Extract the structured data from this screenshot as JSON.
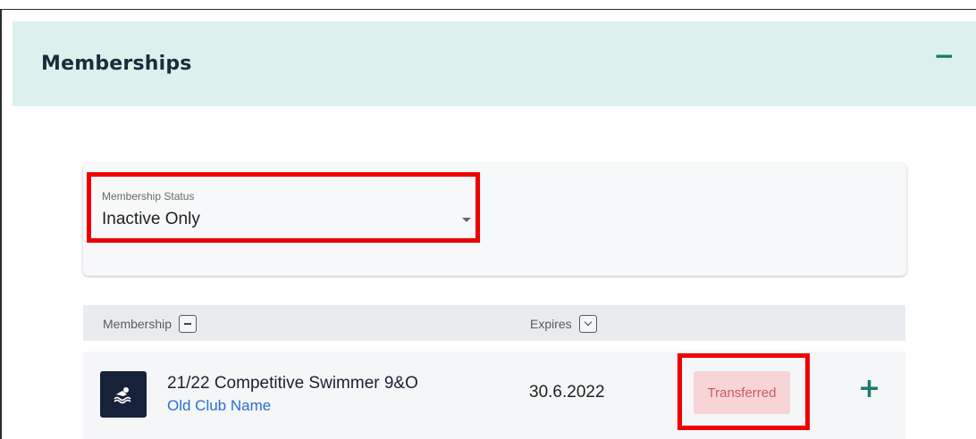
{
  "panel": {
    "title": "Memberships",
    "collapse_symbol": "−"
  },
  "filter": {
    "label": "Membership Status",
    "value": "Inactive Only"
  },
  "table": {
    "columns": [
      "Membership",
      "Expires"
    ],
    "rows": [
      {
        "icon": "swimmer-icon",
        "title": "21/22 Competitive Swimmer 9&O",
        "club": "Old Club Name",
        "expires": "30.6.2022",
        "status": "Transferred",
        "expand_symbol": "+"
      }
    ]
  },
  "colors": {
    "header_bg": "#dcf1ee",
    "accent": "#15796b",
    "highlight": "#ee0000",
    "status_bg": "#f7d4d6",
    "status_text": "#cc5b63",
    "link": "#2b6fc9"
  }
}
